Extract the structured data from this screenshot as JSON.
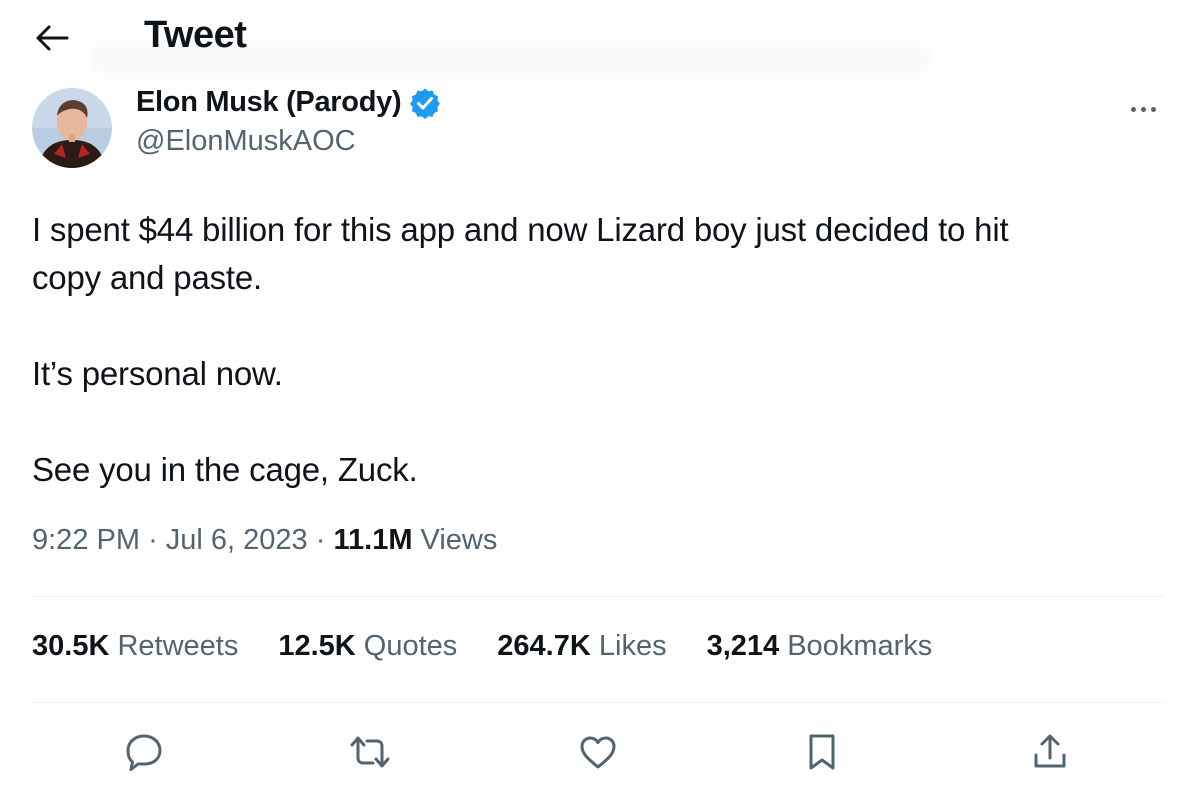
{
  "header": {
    "title": "Tweet",
    "back_icon": "arrow-left-icon"
  },
  "author": {
    "display_name": "Elon Musk (Parody)",
    "handle": "@ElonMuskAOC",
    "verified_color": "#1d9bf0"
  },
  "tweet": {
    "lines": [
      "I spent $44 billion for this app and now Lizard boy just decided to hit",
      "copy and paste.",
      "It’s personal now.",
      "See you in the cage, Zuck."
    ]
  },
  "meta": {
    "time": "9:22 PM",
    "separator": "·",
    "date": "Jul 6, 2023",
    "views_count": "11.1M",
    "views_label": "Views"
  },
  "stats": [
    {
      "count": "30.5K",
      "label": "Retweets"
    },
    {
      "count": "12.5K",
      "label": "Quotes"
    },
    {
      "count": "264.7K",
      "label": "Likes"
    },
    {
      "count": "3,214",
      "label": "Bookmarks"
    }
  ],
  "actions": [
    "reply-icon",
    "retweet-icon",
    "like-icon",
    "bookmark-icon",
    "share-icon"
  ],
  "colors": {
    "text_primary": "#0f1419",
    "text_secondary": "#536471",
    "divider": "#eff3f4",
    "accent": "#1d9bf0"
  }
}
